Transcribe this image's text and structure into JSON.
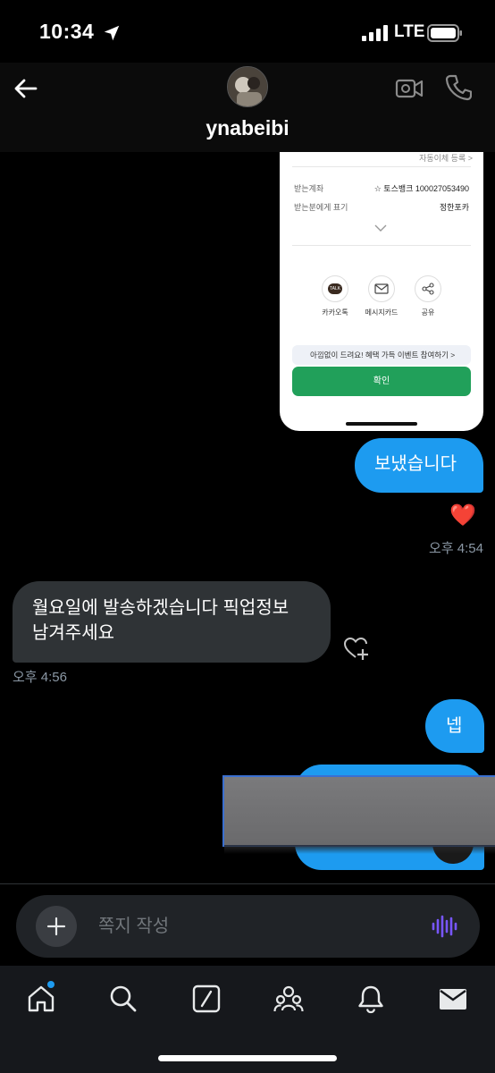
{
  "status_bar": {
    "time": "10:34",
    "carrier": "LTE"
  },
  "header": {
    "username": "ynabeibi"
  },
  "receipt": {
    "autopay_link": "자동이체 등록 >",
    "account_label": "받는계좌",
    "account_value": "☆ 토스뱅크 100027053490",
    "display_label": "받는분에게 표기",
    "display_value": "정한포카",
    "share_options": [
      {
        "label": "카카오톡",
        "icon": "kakaotalk-icon"
      },
      {
        "label": "메시지카드",
        "icon": "envelope-icon"
      },
      {
        "label": "공유",
        "icon": "share-icon"
      }
    ],
    "banner_text": "아낌없이 드려요! 혜택 가득 이벤트 참여하기  >",
    "confirm_label": "확인",
    "colors": {
      "confirm": "#21a05a"
    }
  },
  "messages": [
    {
      "direction": "out",
      "text": "보냈습니다",
      "reaction": "❤️",
      "time": "오후 4:54"
    },
    {
      "direction": "in",
      "text_lines": [
        "월요일에 발송하겠습니다 픽업정보",
        "남겨주세요"
      ],
      "time": "오후 4:56"
    },
    {
      "direction": "out",
      "text": "넵"
    }
  ],
  "composer": {
    "placeholder": "쪽지 작성"
  },
  "tab_bar": {
    "items": [
      {
        "name": "home",
        "icon": "home-icon",
        "badge": true
      },
      {
        "name": "search",
        "icon": "search-icon"
      },
      {
        "name": "grok",
        "icon": "grok-icon"
      },
      {
        "name": "communities",
        "icon": "people-icon"
      },
      {
        "name": "notifications",
        "icon": "bell-icon"
      },
      {
        "name": "messages",
        "icon": "envelope-icon",
        "active": true
      }
    ]
  },
  "colors": {
    "accent": "#1d9bf0",
    "bubble_in": "#2f3336",
    "background": "#000000",
    "voice": "#7856ff"
  }
}
